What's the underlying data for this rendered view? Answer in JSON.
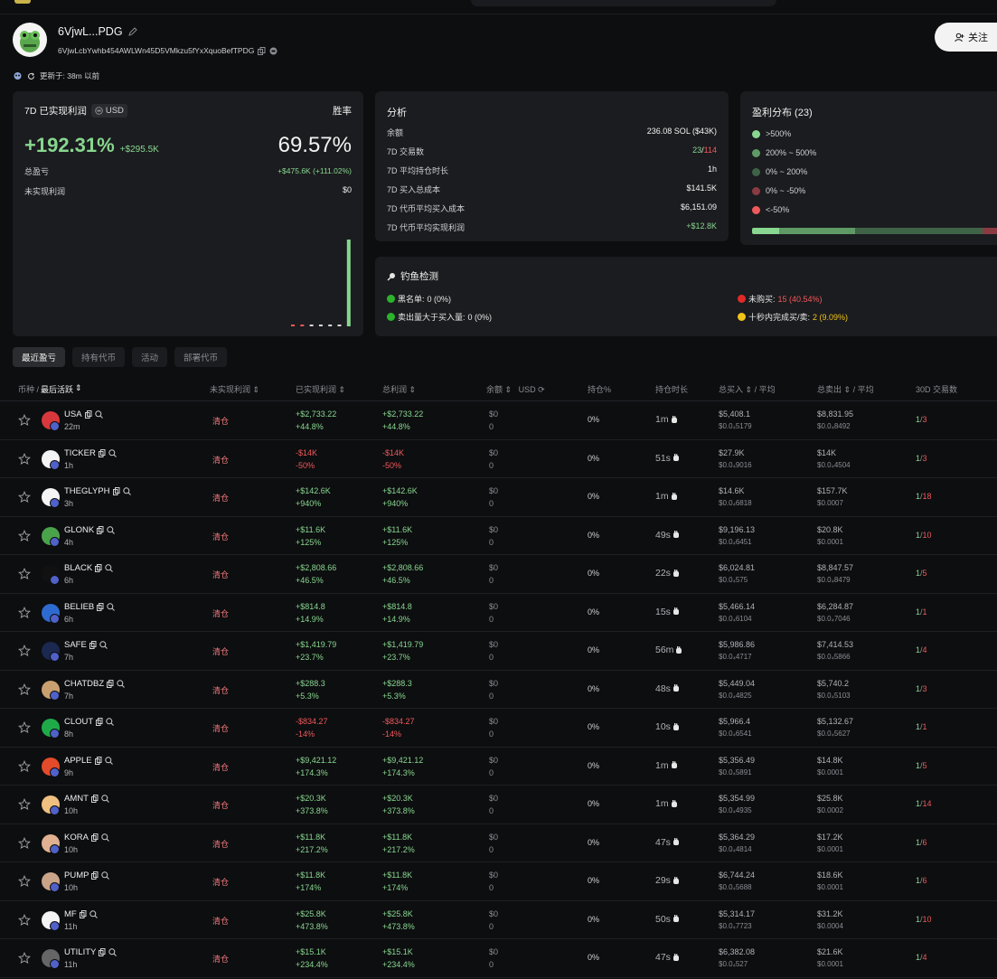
{
  "header": {
    "wallet_short": "6VjwL...PDG",
    "wallet_full": "6VjwLcbYwhb454AWLWn45D5VMkzu5fYxXquoBefTPDG",
    "updated_label": "更新于: 38m 以前",
    "follow_label": "关注"
  },
  "pnl_card": {
    "title": "7D 已实现利润",
    "currency": "USD",
    "winrate_label": "胜率",
    "pnl_pct": "+192.31%",
    "pnl_usd": "+$295.5K",
    "winrate": "69.57%",
    "total_pnl_label": "总盈亏",
    "total_pnl_value": "+$475.6K (+111.02%)",
    "unrealized_label": "未实现利润",
    "unrealized_value": "$0",
    "bars": [
      0.02,
      0.02,
      0.02,
      0.02,
      0.02,
      0.02,
      1.0
    ],
    "bar_colors": [
      "#f0595b",
      "#f0595b",
      "#d8d8d8",
      "#d8d8d8",
      "#d8d8d8",
      "#d8d8d8",
      "#88d68f"
    ]
  },
  "analysis": {
    "title": "分析",
    "rows": [
      {
        "label": "余额",
        "value": "236.08 SOL ($43K)"
      },
      {
        "label": "7D 交易数",
        "value_a": "23",
        "sep": "/",
        "value_b": "114"
      },
      {
        "label": "7D 平均持仓时长",
        "value": "1h"
      },
      {
        "label": "7D 买入总成本",
        "value": "$141.5K"
      },
      {
        "label": "7D 代币平均买入成本",
        "value": "$6,151.09"
      },
      {
        "label": "7D 代币平均实现利润",
        "value": "+$12.8K"
      }
    ]
  },
  "distribution": {
    "title": "盈利分布 (23)",
    "items": [
      {
        "label": ">500%",
        "color": "#88d68f"
      },
      {
        "label": "200% ~ 500%",
        "color": "#5f9a66"
      },
      {
        "label": "0% ~ 200%",
        "color": "#3f6347"
      },
      {
        "label": "0% ~ -50%",
        "color": "#8a3b42"
      },
      {
        "label": "<-50%",
        "color": "#f0595b"
      }
    ],
    "bar_segments": [
      {
        "share": 0.11,
        "color": "#88d68f"
      },
      {
        "share": 0.3,
        "color": "#5f9a66"
      },
      {
        "share": 0.51,
        "color": "#3f6347"
      },
      {
        "share": 0.06,
        "color": "#8a3b42"
      },
      {
        "share": 0.02,
        "color": "#f0595b"
      }
    ]
  },
  "phishing": {
    "title": "钓鱼检测",
    "blacklist_label": "黑名单:",
    "blacklist_value": "0 (0%)",
    "sell_gt_buy_label": "卖出量大于买入量:",
    "sell_gt_buy_value": "0 (0%)",
    "not_bought_label": "未购买:",
    "not_bought_value": "15 (40.54%)",
    "fast_trade_label": "十秒内完成买/卖:",
    "fast_trade_value": "2 (9.09%)"
  },
  "tabs": [
    "最近盈亏",
    "持有代币",
    "活动",
    "部署代币"
  ],
  "table": {
    "headers": {
      "coin": "币种 /",
      "last_active": "最后活跃",
      "unrealized": "未实现利润",
      "realized": "已实现利润",
      "total": "总利润",
      "balance": "余额",
      "balance_unit": "USD",
      "position": "持仓%",
      "hold": "持仓时长",
      "buy": "总买入",
      "buy_avg": "/ 平均",
      "sell": "总卖出",
      "sell_avg": "/ 平均",
      "trades": "30D 交易数"
    },
    "rows": [
      {
        "symbol": "USA",
        "age": "22m",
        "unrealized": "清仓",
        "realized": "+$2,733.22",
        "realized_pct": "+44.8%",
        "total": "+$2,733.22",
        "total_pct": "+44.8%",
        "balance": "$0",
        "balance_qty": "0",
        "position": "0%",
        "hold": "1m",
        "buy": "$5,408.1",
        "buy_avg": "$0.0₄5179",
        "sell": "$8,831.95",
        "sell_avg": "$0.0₄8492",
        "t_a": "1",
        "t_b": "3",
        "pos": true
      },
      {
        "symbol": "TICKER",
        "age": "1h",
        "unrealized": "清仓",
        "realized": "-$14K",
        "realized_pct": "-50%",
        "total": "-$14K",
        "total_pct": "-50%",
        "balance": "$0",
        "balance_qty": "0",
        "position": "0%",
        "hold": "51s",
        "buy": "$27.9K",
        "buy_avg": "$0.0₄9016",
        "sell": "$14K",
        "sell_avg": "$0.0₄4504",
        "t_a": "1",
        "t_b": "3",
        "pos": false
      },
      {
        "symbol": "THEGLYPH",
        "age": "3h",
        "unrealized": "清仓",
        "realized": "+$142.6K",
        "realized_pct": "+940%",
        "total": "+$142.6K",
        "total_pct": "+940%",
        "balance": "$0",
        "balance_qty": "0",
        "position": "0%",
        "hold": "1m",
        "buy": "$14.6K",
        "buy_avg": "$0.0₄6818",
        "sell": "$157.7K",
        "sell_avg": "$0.0007",
        "t_a": "1",
        "t_b": "18",
        "pos": true
      },
      {
        "symbol": "GLONK",
        "age": "4h",
        "unrealized": "清仓",
        "realized": "+$11.6K",
        "realized_pct": "+125%",
        "total": "+$11.6K",
        "total_pct": "+125%",
        "balance": "$0",
        "balance_qty": "0",
        "position": "0%",
        "hold": "49s",
        "buy": "$9,196.13",
        "buy_avg": "$0.0₄6451",
        "sell": "$20.8K",
        "sell_avg": "$0.0001",
        "t_a": "1",
        "t_b": "10",
        "pos": true
      },
      {
        "symbol": "BLACK",
        "age": "6h",
        "unrealized": "清仓",
        "realized": "+$2,808.66",
        "realized_pct": "+46.5%",
        "total": "+$2,808.66",
        "total_pct": "+46.5%",
        "balance": "$0",
        "balance_qty": "0",
        "position": "0%",
        "hold": "22s",
        "buy": "$6,024.81",
        "buy_avg": "$0.0₄575",
        "sell": "$8,847.57",
        "sell_avg": "$0.0₄8479",
        "t_a": "1",
        "t_b": "5",
        "pos": true
      },
      {
        "symbol": "BELIEB",
        "age": "6h",
        "unrealized": "清仓",
        "realized": "+$814.8",
        "realized_pct": "+14.9%",
        "total": "+$814.8",
        "total_pct": "+14.9%",
        "balance": "$0",
        "balance_qty": "0",
        "position": "0%",
        "hold": "15s",
        "buy": "$5,466.14",
        "buy_avg": "$0.0₄6104",
        "sell": "$6,284.87",
        "sell_avg": "$0.0₄7046",
        "t_a": "1",
        "t_b": "1",
        "pos": true
      },
      {
        "symbol": "SAFE",
        "age": "7h",
        "unrealized": "清仓",
        "realized": "+$1,419.79",
        "realized_pct": "+23.7%",
        "total": "+$1,419.79",
        "total_pct": "+23.7%",
        "balance": "$0",
        "balance_qty": "0",
        "position": "0%",
        "hold": "56m",
        "buy": "$5,986.86",
        "buy_avg": "$0.0₄4717",
        "sell": "$7,414.53",
        "sell_avg": "$0.0₄5866",
        "t_a": "1",
        "t_b": "4",
        "pos": true
      },
      {
        "symbol": "CHATDBZ",
        "age": "7h",
        "unrealized": "清仓",
        "realized": "+$288.3",
        "realized_pct": "+5.3%",
        "total": "+$288.3",
        "total_pct": "+5.3%",
        "balance": "$0",
        "balance_qty": "0",
        "position": "0%",
        "hold": "48s",
        "buy": "$5,449.04",
        "buy_avg": "$0.0₄4825",
        "sell": "$5,740.2",
        "sell_avg": "$0.0₄5103",
        "t_a": "1",
        "t_b": "3",
        "pos": true
      },
      {
        "symbol": "CLOUT",
        "age": "8h",
        "unrealized": "清仓",
        "realized": "-$834.27",
        "realized_pct": "-14%",
        "total": "-$834.27",
        "total_pct": "-14%",
        "balance": "$0",
        "balance_qty": "0",
        "position": "0%",
        "hold": "10s",
        "buy": "$5,966.4",
        "buy_avg": "$0.0₄6541",
        "sell": "$5,132.67",
        "sell_avg": "$0.0₄5627",
        "t_a": "1",
        "t_b": "1",
        "pos": false
      },
      {
        "symbol": "APPLE",
        "age": "9h",
        "unrealized": "清仓",
        "realized": "+$9,421.12",
        "realized_pct": "+174.3%",
        "total": "+$9,421.12",
        "total_pct": "+174.3%",
        "balance": "$0",
        "balance_qty": "0",
        "position": "0%",
        "hold": "1m",
        "buy": "$5,356.49",
        "buy_avg": "$0.0₄5891",
        "sell": "$14.8K",
        "sell_avg": "$0.0001",
        "t_a": "1",
        "t_b": "5",
        "pos": true
      },
      {
        "symbol": "AMNT",
        "age": "10h",
        "unrealized": "清仓",
        "realized": "+$20.3K",
        "realized_pct": "+373.8%",
        "total": "+$20.3K",
        "total_pct": "+373.8%",
        "balance": "$0",
        "balance_qty": "0",
        "position": "0%",
        "hold": "1m",
        "buy": "$5,354.99",
        "buy_avg": "$0.0₄4935",
        "sell": "$25.8K",
        "sell_avg": "$0.0002",
        "t_a": "1",
        "t_b": "14",
        "pos": true
      },
      {
        "symbol": "KORA",
        "age": "10h",
        "unrealized": "清仓",
        "realized": "+$11.8K",
        "realized_pct": "+217.2%",
        "total": "+$11.8K",
        "total_pct": "+217.2%",
        "balance": "$0",
        "balance_qty": "0",
        "position": "0%",
        "hold": "47s",
        "buy": "$5,364.29",
        "buy_avg": "$0.0₄4814",
        "sell": "$17.2K",
        "sell_avg": "$0.0001",
        "t_a": "1",
        "t_b": "6",
        "pos": true
      },
      {
        "symbol": "PUMP",
        "age": "10h",
        "unrealized": "清仓",
        "realized": "+$11.8K",
        "realized_pct": "+174%",
        "total": "+$11.8K",
        "total_pct": "+174%",
        "balance": "$0",
        "balance_qty": "0",
        "position": "0%",
        "hold": "29s",
        "buy": "$6,744.24",
        "buy_avg": "$0.0₄5688",
        "sell": "$18.6K",
        "sell_avg": "$0.0001",
        "t_a": "1",
        "t_b": "6",
        "pos": true
      },
      {
        "symbol": "MF",
        "age": "11h",
        "unrealized": "清仓",
        "realized": "+$25.8K",
        "realized_pct": "+473.8%",
        "total": "+$25.8K",
        "total_pct": "+473.8%",
        "balance": "$0",
        "balance_qty": "0",
        "position": "0%",
        "hold": "50s",
        "buy": "$5,314.17",
        "buy_avg": "$0.0₄7723",
        "sell": "$31.2K",
        "sell_avg": "$0.0004",
        "t_a": "1",
        "t_b": "10",
        "pos": true
      },
      {
        "symbol": "UTILITY",
        "age": "11h",
        "unrealized": "清仓",
        "realized": "+$15.1K",
        "realized_pct": "+234.4%",
        "total": "+$15.1K",
        "total_pct": "+234.4%",
        "balance": "$0",
        "balance_qty": "0",
        "position": "0%",
        "hold": "47s",
        "buy": "$6,382.08",
        "buy_avg": "$0.0₄527",
        "sell": "$21.6K",
        "sell_avg": "$0.0001",
        "t_a": "1",
        "t_b": "4",
        "pos": true
      }
    ]
  }
}
